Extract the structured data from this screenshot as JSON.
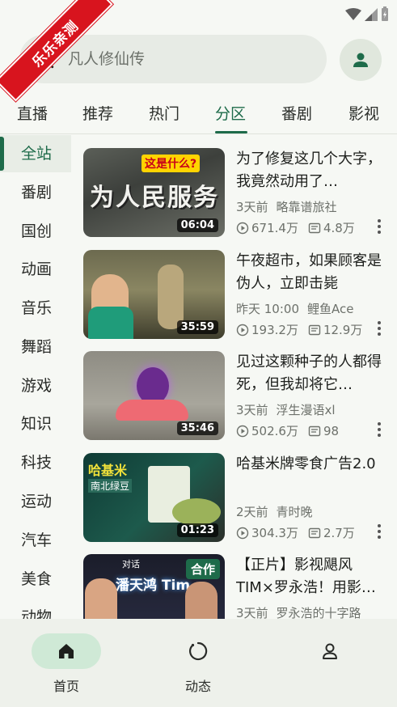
{
  "watermark": "乐乐亲测",
  "search": {
    "placeholder": "凡人修仙传"
  },
  "tabs": [
    {
      "label": "直播"
    },
    {
      "label": "推荐"
    },
    {
      "label": "热门"
    },
    {
      "label": "分区",
      "active": true
    },
    {
      "label": "番剧"
    },
    {
      "label": "影视"
    }
  ],
  "sidebar": {
    "items": [
      {
        "label": "全站",
        "active": true
      },
      {
        "label": "番剧"
      },
      {
        "label": "国创"
      },
      {
        "label": "动画"
      },
      {
        "label": "音乐"
      },
      {
        "label": "舞蹈"
      },
      {
        "label": "游戏"
      },
      {
        "label": "知识"
      },
      {
        "label": "科技"
      },
      {
        "label": "运动"
      },
      {
        "label": "汽车"
      },
      {
        "label": "美食"
      },
      {
        "label": "动物"
      }
    ]
  },
  "videos": [
    {
      "title": "为了修复这几个大字，我竟然动用了…",
      "time": "3天前",
      "author": "略靠谱旅社",
      "views": "671.4万",
      "danmaku": "4.8万",
      "duration": "06:04",
      "thumb_text": "为人民服务",
      "thumb_caption": "这是什么?"
    },
    {
      "title": "午夜超市，如果顾客是伪人，立即击毙",
      "time": "昨天 10:00",
      "author": "鲤鱼Ace",
      "views": "193.2万",
      "danmaku": "12.9万",
      "duration": "35:59"
    },
    {
      "title": "见过这颗种子的人都得死，但我却将它…",
      "time": "3天前",
      "author": "浮生漫语xl",
      "views": "502.6万",
      "danmaku": "98",
      "duration": "35:46"
    },
    {
      "title": "哈基米牌零食广告2.0",
      "time": "2天前",
      "author": "青时晚",
      "views": "304.3万",
      "danmaku": "2.7万",
      "duration": "01:23",
      "thumb_text": "哈基米",
      "thumb_sub": "南北绿豆"
    },
    {
      "title": "【正片】影视飓风TIM×罗永浩！用影…",
      "time": "3天前",
      "author": "罗永浩的十字路",
      "badge": "合作",
      "thumb_text": "潘天鸿 Tim",
      "thumb_sub": "对话"
    }
  ],
  "bottom_nav": [
    {
      "label": "首页",
      "icon": "home-icon",
      "active": true
    },
    {
      "label": "动态",
      "icon": "refresh-icon"
    },
    {
      "label": "",
      "icon": "person-icon"
    }
  ],
  "colors": {
    "accent": "#1e6b4a",
    "background": "#f6f8f4",
    "nav_pill": "#cfe9d6",
    "watermark": "#d8141e"
  }
}
